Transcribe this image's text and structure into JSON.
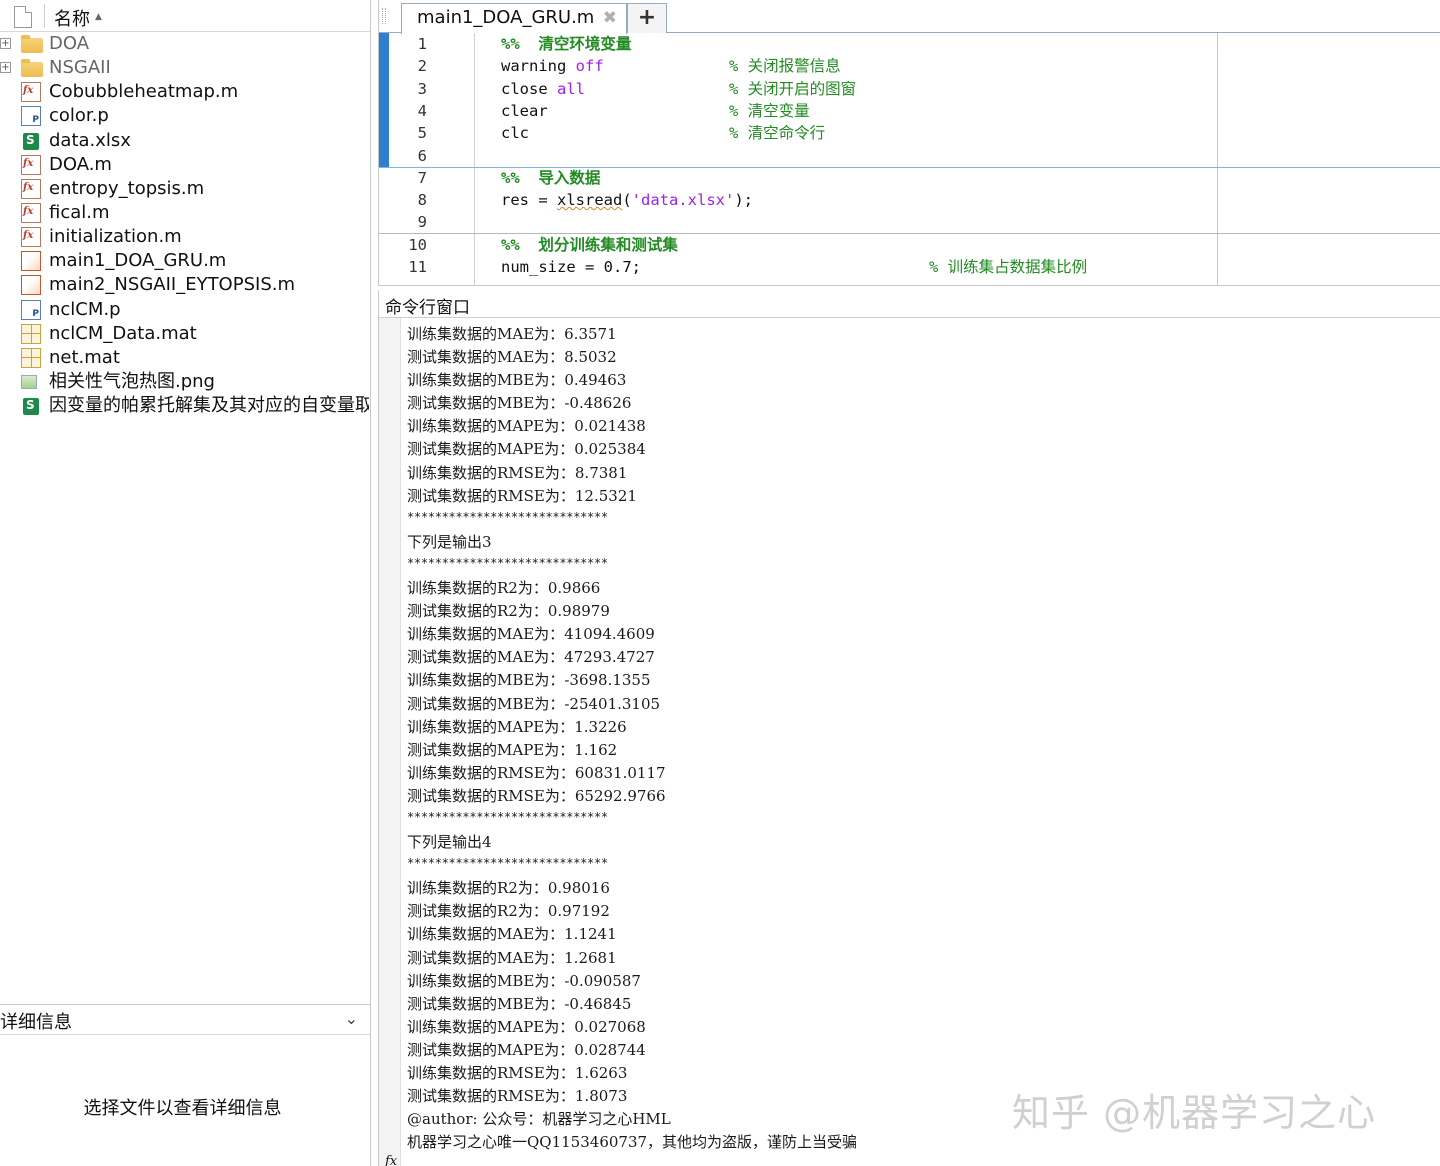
{
  "file_browser": {
    "column_name": "名称",
    "items": [
      {
        "name": "DOA",
        "type": "folder",
        "icon": "folder-icon",
        "expandable": true
      },
      {
        "name": "NSGAII",
        "type": "folder",
        "icon": "folder-icon",
        "expandable": true
      },
      {
        "name": "Cobubbleheatmap.m",
        "type": "function",
        "icon": "matlab-function-icon"
      },
      {
        "name": "color.p",
        "type": "pcode",
        "icon": "pcode-file-icon"
      },
      {
        "name": "data.xlsx",
        "type": "xlsx",
        "icon": "excel-file-icon"
      },
      {
        "name": "DOA.m",
        "type": "function",
        "icon": "matlab-function-icon"
      },
      {
        "name": "entropy_topsis.m",
        "type": "function",
        "icon": "matlab-function-icon"
      },
      {
        "name": "fical.m",
        "type": "function",
        "icon": "matlab-function-icon"
      },
      {
        "name": "initialization.m",
        "type": "function",
        "icon": "matlab-function-icon"
      },
      {
        "name": "main1_DOA_GRU.m",
        "type": "script",
        "icon": "matlab-script-icon"
      },
      {
        "name": "main2_NSGAII_EYTOPSIS.m",
        "type": "script",
        "icon": "matlab-script-icon"
      },
      {
        "name": "nclCM.p",
        "type": "pcode",
        "icon": "pcode-file-icon"
      },
      {
        "name": "nclCM_Data.mat",
        "type": "mat",
        "icon": "mat-file-icon"
      },
      {
        "name": "net.mat",
        "type": "mat",
        "icon": "mat-file-icon"
      },
      {
        "name": "相关性气泡热图.png",
        "type": "png",
        "icon": "image-file-icon"
      },
      {
        "name": "因变量的帕累托解集及其对应的自变量取..",
        "type": "xlsx",
        "icon": "excel-file-icon"
      }
    ],
    "details_title": "详细信息",
    "details_empty": "选择文件以查看详细信息"
  },
  "editor": {
    "tab_label": "main1_DOA_GRU.m",
    "add_tab_label": "+",
    "close_glyph": "✖",
    "lines": [
      {
        "n": "1",
        "code": [
          {
            "t": "%%  清空环境变量",
            "c": "kw-cmt"
          }
        ],
        "comment": ""
      },
      {
        "n": "2",
        "code": [
          {
            "t": "warning ",
            "c": ""
          },
          {
            "t": "off",
            "c": "str"
          }
        ],
        "comment": "% 关闭报警信息"
      },
      {
        "n": "3",
        "code": [
          {
            "t": "close ",
            "c": ""
          },
          {
            "t": "all",
            "c": "str"
          }
        ],
        "comment": "% 关闭开启的图窗"
      },
      {
        "n": "4",
        "code": [
          {
            "t": "clear",
            "c": ""
          }
        ],
        "comment": "% 清空变量"
      },
      {
        "n": "5",
        "code": [
          {
            "t": "clc",
            "c": ""
          }
        ],
        "comment": "% 清空命令行"
      },
      {
        "n": "6",
        "code": [],
        "comment": ""
      },
      {
        "n": "7",
        "code": [
          {
            "t": "%%  导入数据",
            "c": "kw-cmt"
          }
        ],
        "comment": ""
      },
      {
        "n": "8",
        "code": [
          {
            "t": "res = ",
            "c": ""
          },
          {
            "t": "xlsread",
            "c": "squiggle"
          },
          {
            "t": "(",
            "c": ""
          },
          {
            "t": "'data.xlsx'",
            "c": "str"
          },
          {
            "t": ");",
            "c": ""
          }
        ],
        "comment": ""
      },
      {
        "n": "9",
        "code": [],
        "comment": ""
      },
      {
        "n": "10",
        "code": [
          {
            "t": "%%  划分训练集和测试集",
            "c": "kw-cmt"
          }
        ],
        "comment": ""
      },
      {
        "n": "11",
        "code": [
          {
            "t": "num_size = 0.7;",
            "c": ""
          }
        ],
        "comment": "% 训练集占数据集比例"
      }
    ]
  },
  "command_window": {
    "title": "命令行窗口",
    "output": [
      "训练集数据的MAE为：6.3571",
      "测试集数据的MAE为：8.5032",
      "训练集数据的MBE为：0.49463",
      "测试集数据的MBE为：-0.48626",
      "训练集数据的MAPE为：0.021438",
      "测试集数据的MAPE为：0.025384",
      "训练集数据的RMSE为：8.7381",
      "测试集数据的RMSE为：12.5321",
      "*****************************",
      "下列是输出3",
      "*****************************",
      "训练集数据的R2为：0.9866",
      "测试集数据的R2为：0.98979",
      "训练集数据的MAE为：41094.4609",
      "测试集数据的MAE为：47293.4727",
      "训练集数据的MBE为：-3698.1355",
      "测试集数据的MBE为：-25401.3105",
      "训练集数据的MAPE为：1.3226",
      "测试集数据的MAPE为：1.162",
      "训练集数据的RMSE为：60831.0117",
      "测试集数据的RMSE为：65292.9766",
      "*****************************",
      "下列是输出4",
      "*****************************",
      "训练集数据的R2为：0.98016",
      "测试集数据的R2为：0.97192",
      "训练集数据的MAE为：1.1241",
      "测试集数据的MAE为：1.2681",
      "训练集数据的MBE为：-0.090587",
      "测试集数据的MBE为：-0.46845",
      "训练集数据的MAPE为：0.027068",
      "测试集数据的MAPE为：0.028744",
      "训练集数据的RMSE为：1.6263",
      "测试集数据的RMSE为：1.8073",
      "@author: 公众号：机器学习之心HML",
      "机器学习之心唯一QQ1153460737，其他均为盗版，谨防上当受骗"
    ],
    "prompt": "fx"
  },
  "watermark": "知乎 @机器学习之心"
}
